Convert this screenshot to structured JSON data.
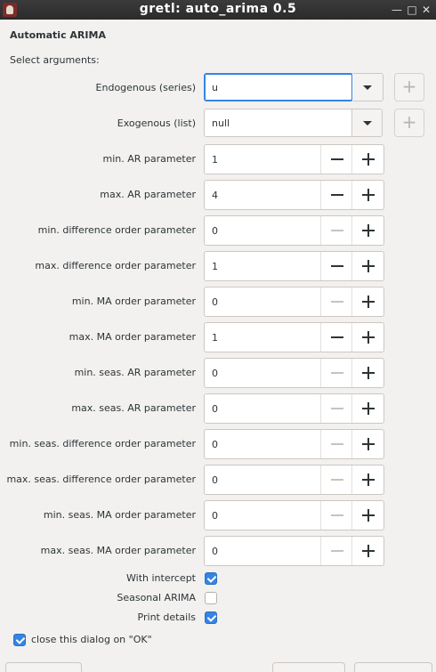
{
  "window": {
    "title": "gretl: auto_arima 0.5",
    "minimize_glyph": "—",
    "maximize_glyph": "□",
    "close_glyph": "✕"
  },
  "section_title": "Automatic ARIMA",
  "select_args_label": "Select arguments:",
  "endogenous": {
    "label": "Endogenous (series)",
    "value": "u"
  },
  "exogenous": {
    "label": "Exogenous (list)",
    "value": "null"
  },
  "spinners": [
    {
      "label": "min. AR parameter",
      "value": "1",
      "minus_enabled": true
    },
    {
      "label": "max. AR parameter",
      "value": "4",
      "minus_enabled": true
    },
    {
      "label": "min. difference order parameter",
      "value": "0",
      "minus_enabled": false
    },
    {
      "label": "max. difference order parameter",
      "value": "1",
      "minus_enabled": true
    },
    {
      "label": "min. MA order parameter",
      "value": "0",
      "minus_enabled": false
    },
    {
      "label": "max. MA order parameter",
      "value": "1",
      "minus_enabled": true
    },
    {
      "label": "min. seas. AR parameter",
      "value": "0",
      "minus_enabled": false
    },
    {
      "label": "max. seas. AR parameter",
      "value": "0",
      "minus_enabled": false
    },
    {
      "label": "min. seas. difference order parameter",
      "value": "0",
      "minus_enabled": false
    },
    {
      "label": "max. seas. difference order parameter",
      "value": "0",
      "minus_enabled": false
    },
    {
      "label": "min. seas. MA order parameter",
      "value": "0",
      "minus_enabled": false
    },
    {
      "label": "max. seas. MA order parameter",
      "value": "0",
      "minus_enabled": false
    }
  ],
  "checkboxes": [
    {
      "label": "With intercept",
      "checked": true
    },
    {
      "label": "Seasonal ARIMA",
      "checked": false
    },
    {
      "label": "Print details",
      "checked": true
    }
  ],
  "close_on_ok": {
    "label": "close this dialog on \"OK\"",
    "checked": true
  },
  "colors": {
    "accent": "#3584e4",
    "titlebar": "#2b2b2b",
    "background": "#f2f1f0"
  },
  "icons": {
    "app": "gretl-app-icon",
    "dropdown": "chevron-down-icon",
    "add": "plus-icon",
    "decrement": "minus-icon"
  }
}
